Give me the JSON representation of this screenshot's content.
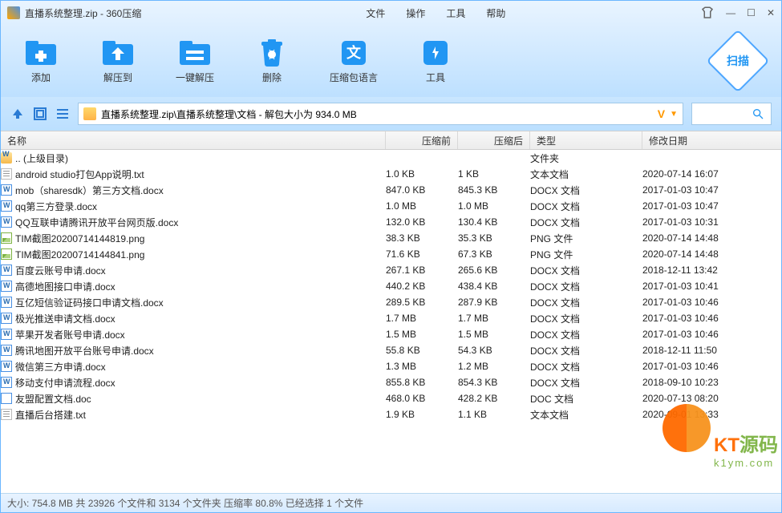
{
  "title": "直播系统整理.zip - 360压缩",
  "menus": [
    "文件",
    "操作",
    "工具",
    "帮助"
  ],
  "toolbar": [
    {
      "key": "add",
      "label": "添加"
    },
    {
      "key": "extract-to",
      "label": "解压到"
    },
    {
      "key": "one-click",
      "label": "一键解压"
    },
    {
      "key": "delete",
      "label": "删除"
    },
    {
      "key": "lang",
      "label": "压缩包语言"
    },
    {
      "key": "tools",
      "label": "工具"
    }
  ],
  "scan_label": "扫描",
  "path_text": "直播系统整理.zip\\直播系统整理\\文档 - 解包大小为 934.0 MB",
  "v_mark": "V",
  "columns": {
    "name": "名称",
    "before": "压缩前",
    "after": "压缩后",
    "type": "类型",
    "date": "修改日期"
  },
  "rows": [
    {
      "icon": "folder",
      "name": ".. (上级目录)",
      "before": "",
      "after": "",
      "type": "文件夹",
      "date": ""
    },
    {
      "icon": "txt",
      "name": "android studio打包App说明.txt",
      "before": "1.0 KB",
      "after": "1 KB",
      "type": "文本文档",
      "date": "2020-07-14 16:07"
    },
    {
      "icon": "docx",
      "name": "mob（sharesdk）第三方文档.docx",
      "before": "847.0 KB",
      "after": "845.3 KB",
      "type": "DOCX 文档",
      "date": "2017-01-03 10:47"
    },
    {
      "icon": "docx",
      "name": "qq第三方登录.docx",
      "before": "1.0 MB",
      "after": "1.0 MB",
      "type": "DOCX 文档",
      "date": "2017-01-03 10:47"
    },
    {
      "icon": "docx",
      "name": "QQ互联申请腾讯开放平台网页版.docx",
      "before": "132.0 KB",
      "after": "130.4 KB",
      "type": "DOCX 文档",
      "date": "2017-01-03 10:31"
    },
    {
      "icon": "png",
      "name": "TIM截图20200714144819.png",
      "before": "38.3 KB",
      "after": "35.3 KB",
      "type": "PNG 文件",
      "date": "2020-07-14 14:48"
    },
    {
      "icon": "png",
      "name": "TIM截图20200714144841.png",
      "before": "71.6 KB",
      "after": "67.3 KB",
      "type": "PNG 文件",
      "date": "2020-07-14 14:48"
    },
    {
      "icon": "docx",
      "name": "百度云账号申请.docx",
      "before": "267.1 KB",
      "after": "265.6 KB",
      "type": "DOCX 文档",
      "date": "2018-12-11 13:42"
    },
    {
      "icon": "docx",
      "name": "高德地图接口申请.docx",
      "before": "440.2 KB",
      "after": "438.4 KB",
      "type": "DOCX 文档",
      "date": "2017-01-03 10:41"
    },
    {
      "icon": "docx",
      "name": "互亿短信验证码接口申请文档.docx",
      "before": "289.5 KB",
      "after": "287.9 KB",
      "type": "DOCX 文档",
      "date": "2017-01-03 10:46"
    },
    {
      "icon": "docx",
      "name": "极光推送申请文档.docx",
      "before": "1.7 MB",
      "after": "1.7 MB",
      "type": "DOCX 文档",
      "date": "2017-01-03 10:46"
    },
    {
      "icon": "docx",
      "name": "苹果开发者账号申请.docx",
      "before": "1.5 MB",
      "after": "1.5 MB",
      "type": "DOCX 文档",
      "date": "2017-01-03 10:46"
    },
    {
      "icon": "docx",
      "name": "腾讯地图开放平台账号申请.docx",
      "before": "55.8 KB",
      "after": "54.3 KB",
      "type": "DOCX 文档",
      "date": "2018-12-11 11:50"
    },
    {
      "icon": "docx",
      "name": "微信第三方申请.docx",
      "before": "1.3 MB",
      "after": "1.2 MB",
      "type": "DOCX 文档",
      "date": "2017-01-03 10:46"
    },
    {
      "icon": "docx",
      "name": "移动支付申请流程.docx",
      "before": "855.8 KB",
      "after": "854.3 KB",
      "type": "DOCX 文档",
      "date": "2018-09-10 10:23"
    },
    {
      "icon": "doc",
      "name": "友盟配置文档.doc",
      "before": "468.0 KB",
      "after": "428.2 KB",
      "type": "DOC 文档",
      "date": "2020-07-13 08:20"
    },
    {
      "icon": "txt",
      "name": "直播后台搭建.txt",
      "before": "1.9 KB",
      "after": "1.1 KB",
      "type": "文本文档",
      "date": "2020-09-01 13:33"
    }
  ],
  "statusbar": "大小: 754.8 MB 共 23926 个文件和 3134 个文件夹 压缩率 80.8% 已经选择 1 个文件",
  "watermark": {
    "main_a": "KT",
    "main_b": "源码",
    "sub": "k1ym.com"
  }
}
